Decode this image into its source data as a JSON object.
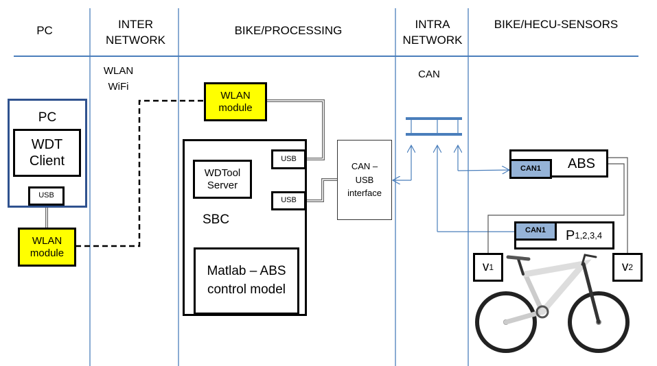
{
  "columns": [
    "PC",
    "INTER NETWORK",
    "BIKE/PROCESSING",
    "INTRA NETWORK",
    "BIKE/HECU-SENSORS"
  ],
  "inter_network_label": "WLAN WiFi",
  "intra_network_label": "CAN",
  "pc": {
    "title": "PC",
    "client": "WDT Client",
    "usb": "USB",
    "wlan": "WLAN module"
  },
  "processing": {
    "wlan": "WLAN module",
    "sbc": "SBC",
    "usb1": "USB",
    "usb2": "USB",
    "server": "WDTool Server",
    "matlab": "Matlab – ABS control model",
    "can_usb": "CAN – USB interface"
  },
  "sensors": {
    "abs": "ABS",
    "abs_can": "CAN1",
    "p": "P",
    "p_sub": "1,2,3,4",
    "p_can": "CAN1",
    "v1": "v",
    "v1_sub": "1",
    "v2": "v",
    "v2_sub": "2"
  },
  "colors": {
    "lines": "#4a7ebb",
    "module": "#ffff00",
    "can": "#95b3d7"
  }
}
